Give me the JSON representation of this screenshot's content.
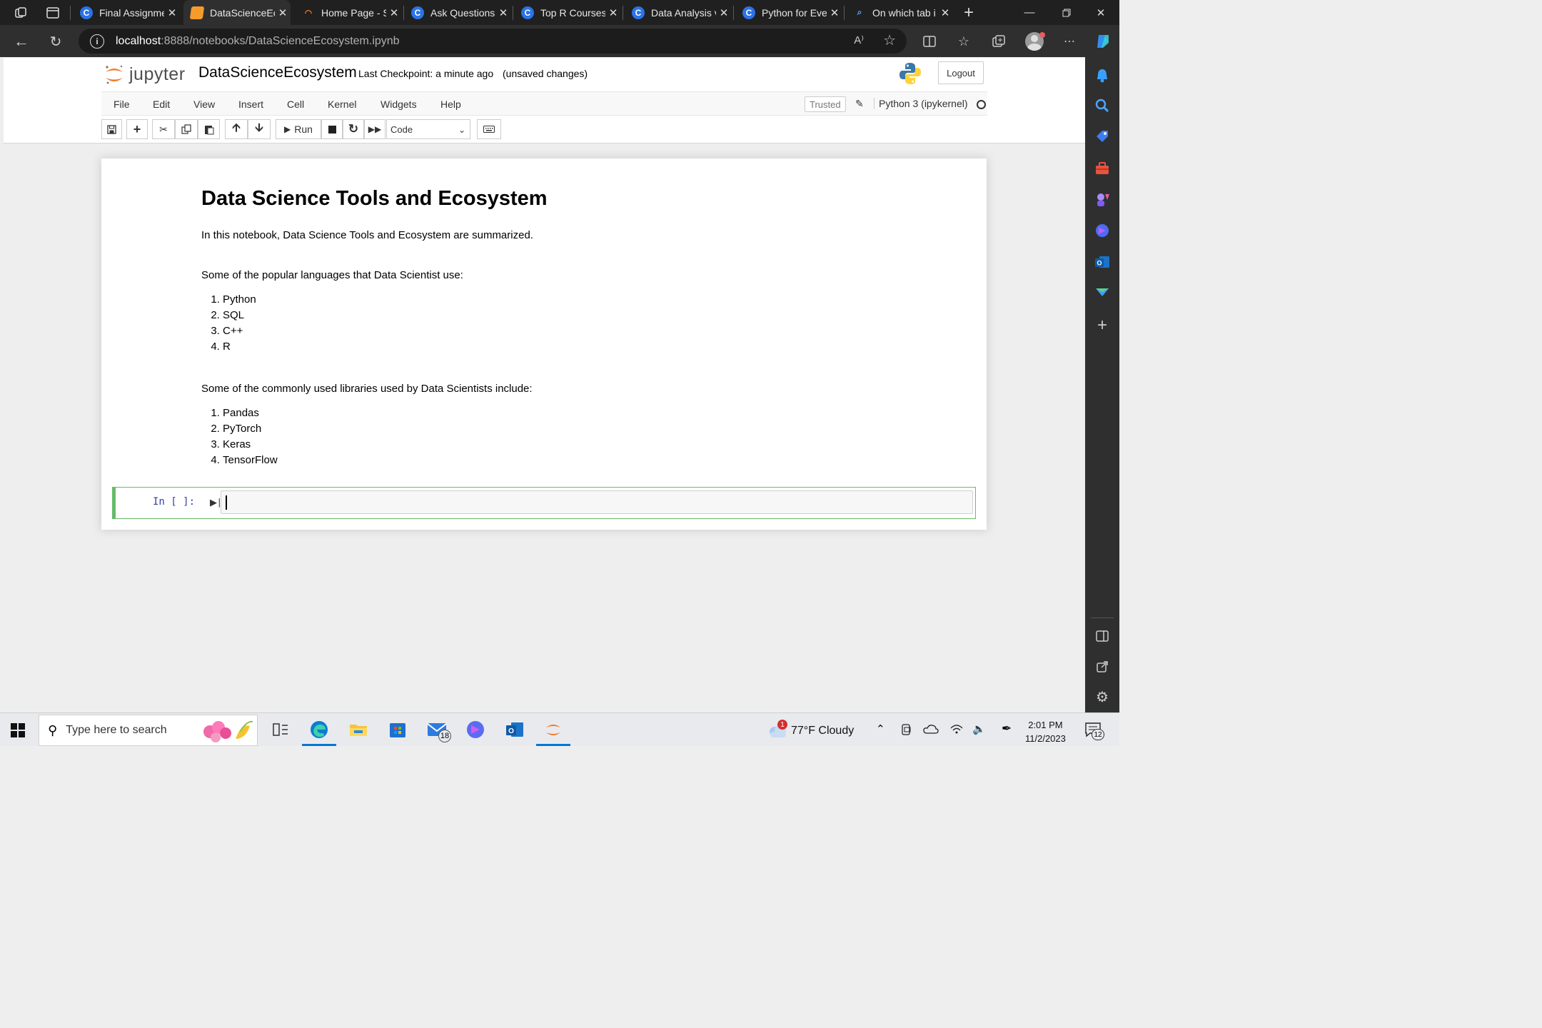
{
  "browser": {
    "tabs": [
      {
        "title": "Final Assignme",
        "favicon": "coursera-icon",
        "active": false
      },
      {
        "title": "DataScienceEc",
        "favicon": "notebook-icon",
        "active": true
      },
      {
        "title": "Home Page - S",
        "favicon": "jupyter-icon",
        "active": false
      },
      {
        "title": "Ask Questions",
        "favicon": "coursera-icon",
        "active": false
      },
      {
        "title": "Top R Courses",
        "favicon": "coursera-icon",
        "active": false
      },
      {
        "title": "Data Analysis v",
        "favicon": "coursera-icon",
        "active": false
      },
      {
        "title": "Python for Eve",
        "favicon": "coursera-icon",
        "active": false
      },
      {
        "title": "On which tab i",
        "favicon": "search-icon",
        "active": false
      }
    ],
    "url_host": "localhost",
    "url_rest": ":8888/notebooks/DataScienceEcosystem.ipynb"
  },
  "jupyter": {
    "brand": "jupyter",
    "notebook_name": "DataScienceEcosystem",
    "checkpoint": "Last Checkpoint: a minute ago",
    "unsaved": "(unsaved changes)",
    "logout_label": "Logout",
    "menus": [
      "File",
      "Edit",
      "View",
      "Insert",
      "Cell",
      "Kernel",
      "Widgets",
      "Help"
    ],
    "trusted_label": "Trusted",
    "kernel_label": "Python 3 (ipykernel)",
    "run_label": "Run",
    "cell_type": "Code"
  },
  "notebook": {
    "title": "Data Science Tools and Ecosystem",
    "intro": "In this notebook, Data Science Tools and Ecosystem are summarized.",
    "languages_heading": "Some of the popular languages that Data Scientist use:",
    "languages": [
      "Python",
      "SQL",
      "C++",
      "R"
    ],
    "libraries_heading": "Some of the commonly used libraries used by Data Scientists include:",
    "libraries": [
      "Pandas",
      "PyTorch",
      "Keras",
      "TensorFlow"
    ],
    "prompt": "In [ ]:"
  },
  "taskbar": {
    "search_placeholder": "Type here to search",
    "mail_badge": "18",
    "weather_badge": "1",
    "weather": "77°F  Cloudy",
    "time": "2:01 PM",
    "date": "11/2/2023",
    "notification_count": "12"
  },
  "colors": {
    "accent": "#0078d4",
    "jupyter_orange": "#f37726",
    "cell_green": "#66bb6a"
  }
}
